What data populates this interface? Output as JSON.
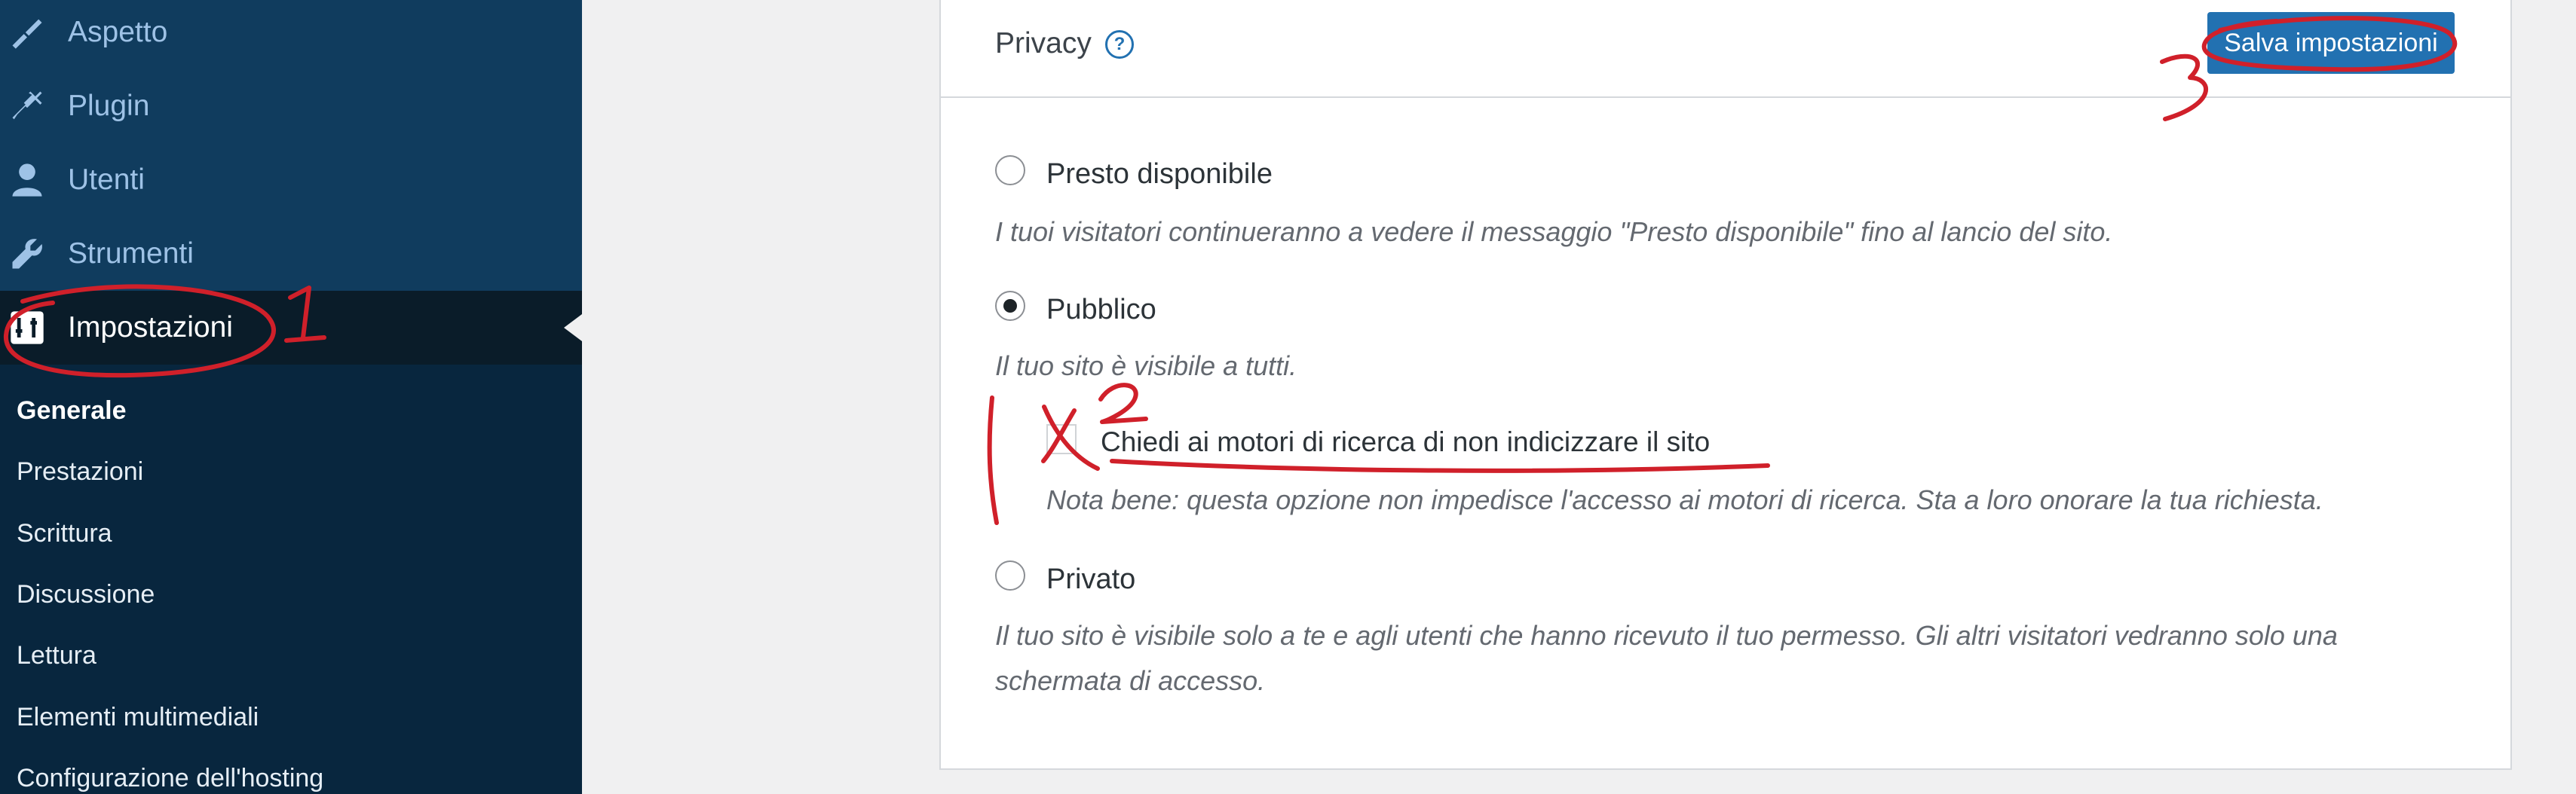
{
  "sidebar": {
    "menu": [
      {
        "label": "Aspetto",
        "icon": "brush-icon"
      },
      {
        "label": "Plugin",
        "icon": "plug-icon"
      },
      {
        "label": "Utenti",
        "icon": "user-icon"
      },
      {
        "label": "Strumenti",
        "icon": "wrench-icon"
      },
      {
        "label": "Impostazioni",
        "icon": "settings-icon"
      }
    ],
    "submenu": [
      {
        "label": "Generale"
      },
      {
        "label": "Prestazioni"
      },
      {
        "label": "Scrittura"
      },
      {
        "label": "Discussione"
      },
      {
        "label": "Lettura"
      },
      {
        "label": "Elementi multimediali"
      },
      {
        "label": "Configurazione dell'hosting"
      }
    ]
  },
  "privacy": {
    "title": "Privacy",
    "help": "?",
    "save_label": "Salva impostazioni",
    "options": [
      {
        "label": "Presto disponibile",
        "description": "I tuoi visitatori continueranno a vedere il messaggio \"Presto disponibile\" fino al lancio del sito.",
        "checked": false
      },
      {
        "label": "Pubblico",
        "description": "Il tuo sito è visibile a tutti.",
        "checked": true
      },
      {
        "label": "Privato",
        "description": "Il tuo sito è visibile solo a te e agli utenti che hanno ricevuto il tuo permesso. Gli altri visitatori vedranno solo una schermata di accesso.",
        "checked": false
      }
    ],
    "noindex": {
      "label": "Chiedi ai motori di ricerca di non indicizzare il sito",
      "note": "Nota bene: questa opzione non impedisce l'accesso ai motori di ricerca. Sta a loro onorare la tua richiesta.",
      "checked": false
    }
  },
  "annotations": {
    "color": "#d0202a",
    "marks": [
      "1",
      "2",
      "3",
      "X"
    ]
  }
}
